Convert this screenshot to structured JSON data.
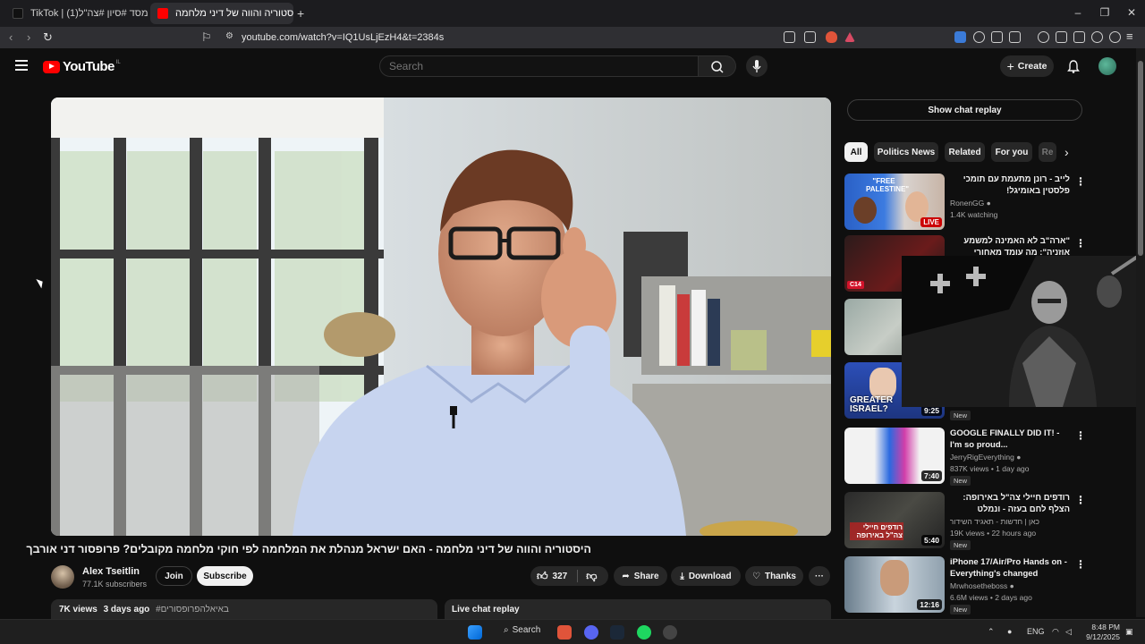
{
  "browser": {
    "tabs": [
      {
        "title": "TikTok | (1)על ידי הממסד #סיון #צה\"ל",
        "active": false
      },
      {
        "title": "היסטוריה והווה של דיני מלחמה",
        "active": true
      }
    ],
    "new_tab": "+",
    "url": "youtube.com/watch?v=IQ1UsLjEzH4&t=2384s"
  },
  "header": {
    "logo_text": "YouTube",
    "logo_super": "IL",
    "search_placeholder": "Search",
    "create_label": "Create"
  },
  "video": {
    "title": "היסטוריה והווה של דיני מלחמה - האם ישראל מנהלת את המלחמה לפי חוקי מלחמה מקובלים? פרופסור דני אורבך",
    "channel_name": "Alex Tseitlin",
    "channel_subs": "77.1K subscribers",
    "join_label": "Join",
    "subscribe_label": "Subscribe",
    "likes": "327",
    "share_label": "Share",
    "download_label": "Download",
    "thanks_label": "Thanks",
    "more_label": "···",
    "views": "7K views",
    "age": "3 days ago",
    "hashtag": "#באיאלהפרופסורים",
    "live_chat_label": "Live chat replay"
  },
  "sidebar": {
    "chat_replay_label": "Show chat replay",
    "chips": [
      "All",
      "Politics News",
      "Related",
      "For you",
      "Re"
    ],
    "recommendations": [
      {
        "title": "לייב - רונן מתעמת עם תומכי פלסטין באומיגל!",
        "channel": "RonenGG",
        "meta": "1.4K watching",
        "badge": "",
        "duration": "",
        "live": "LIVE",
        "thumb_text": "\"FREE PALESTINE\""
      },
      {
        "title": "\"ארה\"ב לא האמינה למשמע אוזניה\": מה עומד מאחורי התקיפה בקטאר?",
        "channel": "",
        "meta": "",
        "badge": "",
        "duration": "",
        "live": "",
        "thumb_text": ""
      },
      {
        "title": "",
        "channel": "",
        "meta": "",
        "badge": "",
        "duration": "",
        "live": "",
        "thumb_text": ""
      },
      {
        "title": "",
        "channel": "",
        "meta": "",
        "badge": "New",
        "duration": "9:25",
        "live": "",
        "thumb_text": "GREATER ISRAEL?"
      },
      {
        "title": "GOOGLE FINALLY DID IT! - I'm so proud...",
        "channel": "JerryRigEverything",
        "meta": "837K views • 1 day ago",
        "badge": "New",
        "duration": "7:40",
        "live": "",
        "thumb_text": ""
      },
      {
        "title": "רודפים חיילי צה\"ל באירופה: הצלף לחם בעזה - ונמלט מגרמניה מחשש",
        "channel": "כאן | חדשות - תאגיד השידור הישראלי",
        "meta": "19K views • 22 hours ago",
        "badge": "New",
        "duration": "5:40",
        "live": "",
        "thumb_text": "רודפים חיילי צה\"ל באירופה"
      },
      {
        "title": "iPhone 17/Air/Pro Hands on - Everything's changed",
        "channel": "Mrwhosetheboss",
        "meta": "6.6M views • 2 days ago",
        "badge": "New",
        "duration": "12:16",
        "live": "",
        "thumb_text": ""
      }
    ]
  },
  "taskbar": {
    "search_label": "Search",
    "lang": "ENG",
    "time": "8:48 PM",
    "date": "9/12/2025"
  }
}
